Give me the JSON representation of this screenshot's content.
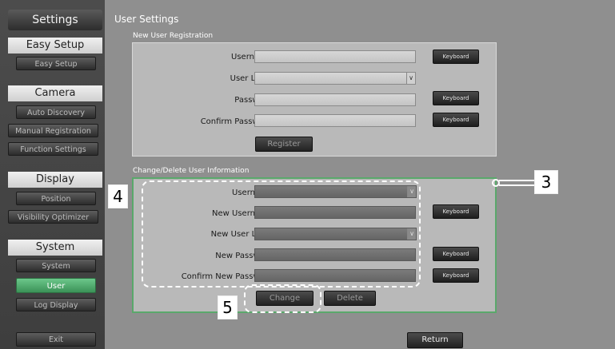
{
  "sidebar": {
    "title": "Settings",
    "sections": {
      "easy_setup": {
        "label": "Easy Setup",
        "items": [
          "Easy Setup"
        ]
      },
      "camera": {
        "label": "Camera",
        "items": [
          "Auto Discovery",
          "Manual Registration",
          "Function Settings"
        ]
      },
      "display": {
        "label": "Display",
        "items": [
          "Position",
          "Visibility Optimizer"
        ]
      },
      "system": {
        "label": "System",
        "items": [
          "System",
          "User",
          "Log Display"
        ]
      }
    },
    "exit_label": "Exit",
    "active_item": "User",
    "accent_color": "#4fae6c"
  },
  "main": {
    "page_title": "User Settings",
    "new_user": {
      "group_label": "New User Registration",
      "username_label": "Username",
      "user_level_label": "User Level",
      "password_label": "Password",
      "confirm_password_label": "Confirm Password",
      "keyboard_label": "Keyboard",
      "register_label": "Register"
    },
    "change_user": {
      "group_label": "Change/Delete User Information",
      "username_label": "Username",
      "new_username_label": "New Username",
      "new_user_level_label": "New User Level",
      "new_password_label": "New Password",
      "confirm_new_password_label": "Confirm New Password",
      "keyboard_label": "Keyboard",
      "change_label": "Change",
      "delete_label": "Delete"
    },
    "return_label": "Return"
  },
  "callouts": {
    "c3": "3",
    "c4": "4",
    "c5": "5"
  },
  "icons": {
    "dropdown": "chevron-down-icon"
  }
}
